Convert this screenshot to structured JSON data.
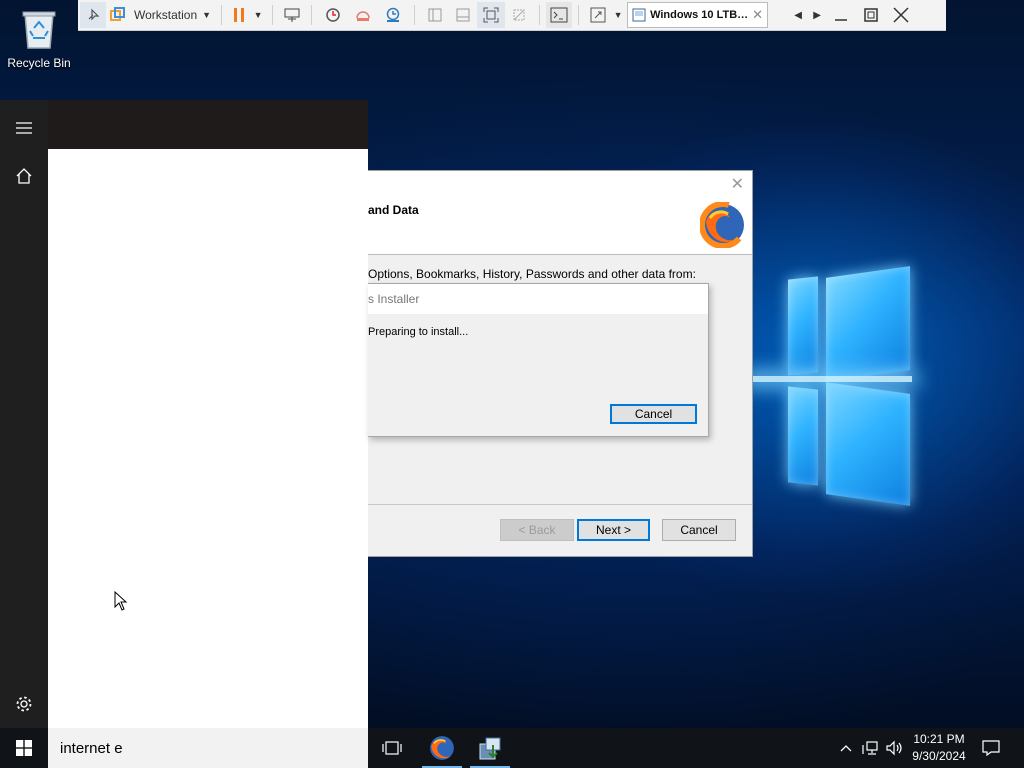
{
  "desktop": {
    "recycle_bin_label": "Recycle Bin"
  },
  "vmware_toolbar": {
    "library_label": "Workstation",
    "vm_tab_label": "Windows 10 LTB…",
    "pause_color": "#f07b1d"
  },
  "start_menu": {
    "icons": [
      "hamburger-icon",
      "home-icon",
      "settings-icon"
    ]
  },
  "installer_dialog": {
    "heading_partial": "and Data",
    "description_partial": "Options, Bookmarks, History, Passwords and other data from:",
    "back_label": "< Back",
    "next_label": "Next >",
    "cancel_label": "Cancel"
  },
  "progress_dialog": {
    "title_partial": "s Installer",
    "status_partial": "Preparing to install...",
    "cancel_label": "Cancel"
  },
  "taskbar": {
    "search_value": "internet e",
    "apps": [
      "task-view-icon",
      "firefox-icon",
      "installer-icon"
    ],
    "time": "10:21 PM",
    "date": "9/30/2024"
  },
  "colors": {
    "accent": "#0078d7",
    "taskbar_bg": "#101418",
    "start_strip_bg": "#1f1f1f"
  }
}
